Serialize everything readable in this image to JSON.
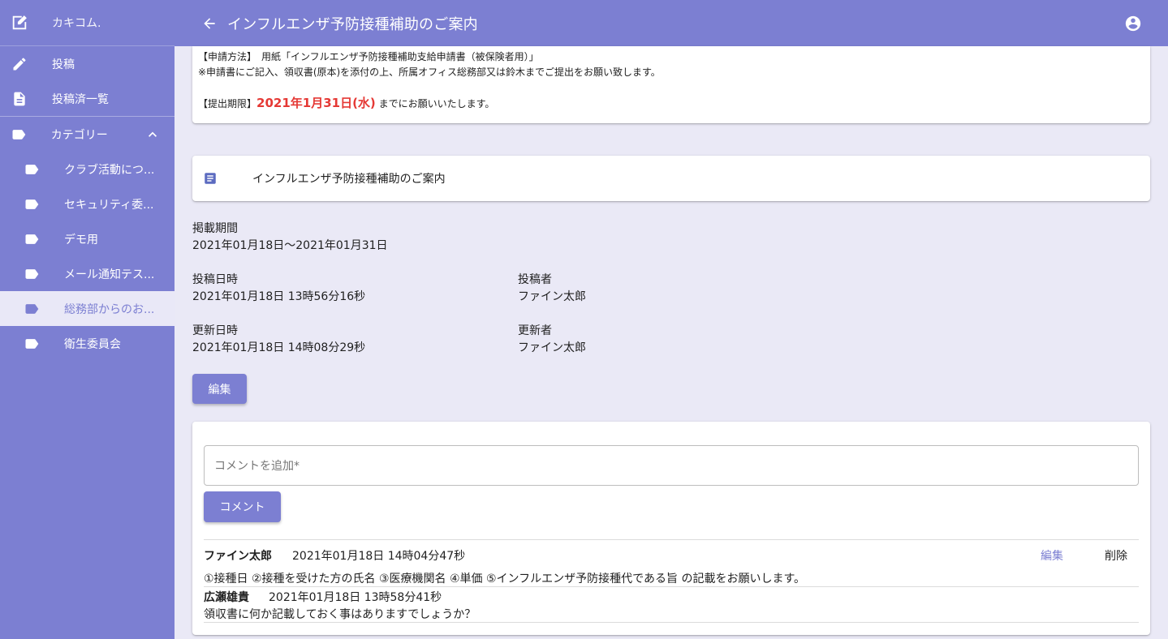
{
  "sidebar": {
    "brand": "カキコム.",
    "items": [
      {
        "label": "投稿",
        "icon": "pencil-icon"
      },
      {
        "label": "投稿済一覧",
        "icon": "document-icon"
      },
      {
        "label": "カテゴリー",
        "icon": "label-icon"
      }
    ],
    "categories": [
      {
        "label": "クラブ活動につ..."
      },
      {
        "label": "セキュリティ委..."
      },
      {
        "label": "デモ用"
      },
      {
        "label": "メール通知テス..."
      },
      {
        "label": "総務部からのお..."
      },
      {
        "label": "衛生委員会"
      }
    ],
    "active_category": "総務部からのお...",
    "colors": {
      "background": "#7c7fd2",
      "active_bg": "#e9e8f7"
    }
  },
  "header": {
    "title": "インフルエンザ予防接種補助のご案内"
  },
  "notice": {
    "line1": "【申請方法】　用紙「インフルエンザ予防接種補助支給申請書（被保険者用）」",
    "line2": "※申請書にご記入、領収書(原本)を添付の上、所属オフィス総務部又は鈴木までご提出をお願い致します。",
    "deadline_label": "【提出期限】",
    "deadline_date": "2021年1月31日(水)",
    "deadline_suffix": " までにお願いいたします。"
  },
  "post": {
    "title": "インフルエンザ予防接種補助のご案内",
    "period_label": "掲載期間",
    "period_value": "2021年01月18日〜2021年01月31日",
    "posted_at_label": "投稿日時",
    "posted_at_value": "2021年01月18日 13時56分16秒",
    "poster_label": "投稿者",
    "poster_value": "ファイン太郎",
    "updated_at_label": "更新日時",
    "updated_at_value": "2021年01月18日 14時08分29秒",
    "updater_label": "更新者",
    "updater_value": "ファイン太郎",
    "edit_label": "編集"
  },
  "comments": {
    "input_placeholder": "コメントを追加*",
    "submit_label": "コメント",
    "list": [
      {
        "author": "ファイン太郎",
        "date": "2021年01月18日 14時04分47秒",
        "body": "①接種日 ②接種を受けた方の氏名 ③医療機関名 ④単価 ⑤インフルエンザ予防接種代である旨 の記載をお願いします。",
        "edit_label": "編集",
        "delete_label": "削除"
      },
      {
        "author": "広瀬雄貴",
        "date": "2021年01月18日 13時58分41秒",
        "body": "領収書に何か記載しておく事はありますでしょうか？"
      }
    ]
  },
  "colors": {
    "accent": "#7c7fd2",
    "deadline": "#e53935",
    "page_bg": "#eae9f6"
  }
}
